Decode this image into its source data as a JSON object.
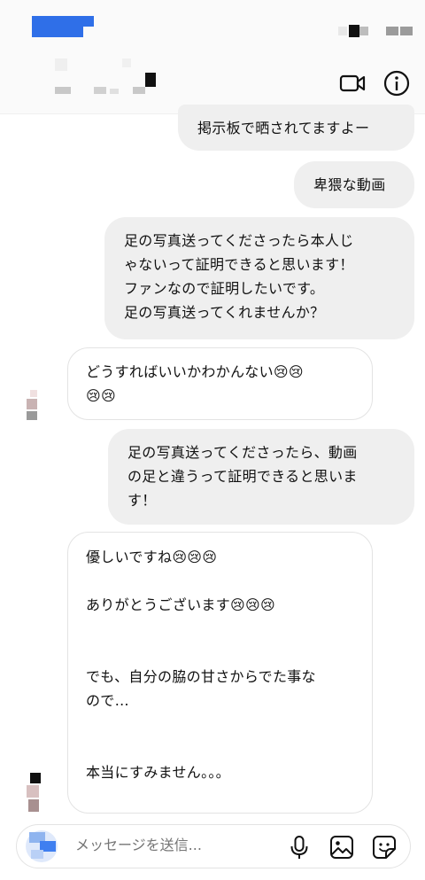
{
  "header": {
    "icons": [
      "video-call-icon",
      "info-icon"
    ]
  },
  "messages": [
    {
      "side": "out",
      "text": "掲示板で晒されてますよー"
    },
    {
      "side": "out",
      "text": "卑猥な動画"
    },
    {
      "side": "out",
      "text": "足の写真送ってくださったら本人じ\nゃないって証明できると思います！\nファンなので証明したいです。\n足の写真送ってくれませんか？"
    },
    {
      "side": "in",
      "text": "どうすればいいかわかんない😢😢\n😢😢"
    },
    {
      "side": "out",
      "text": "足の写真送ってくださったら、動画\nの足と違うって証明できると思いま\nす！"
    },
    {
      "side": "in",
      "text": "優しいですね😢😢😢\n\nありがとうございます😢😢😢\n\n\nでも、自分の脇の甘さからでた事な\nので…\n\n\n本当にすみません。。。"
    }
  ],
  "composer": {
    "placeholder": "メッセージを送信...",
    "icons": [
      "microphone-icon",
      "image-icon",
      "sticker-icon"
    ]
  }
}
